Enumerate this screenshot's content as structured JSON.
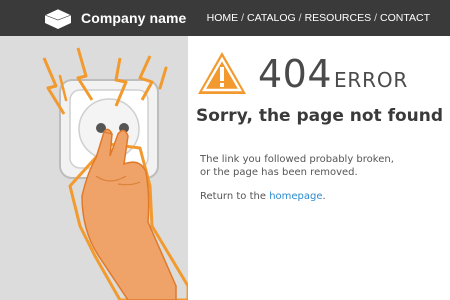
{
  "header": {
    "brand": "Company name",
    "nav": [
      {
        "label": "HOME"
      },
      {
        "label": "CATALOG"
      },
      {
        "label": "RESOURCES"
      },
      {
        "label": "CONTACT"
      }
    ],
    "separator": "/"
  },
  "error": {
    "code": "404",
    "word": "ERROR",
    "title": "Sorry, the page not found",
    "message_line1": "The link you followed probably broken,",
    "message_line2": "or the page has been removed.",
    "return_prefix": "Return to the",
    "return_link": "homepage",
    "return_suffix": "."
  },
  "colors": {
    "topbar": "#3a3a3a",
    "illustration_bg": "#dcdcdc",
    "accent_orange": "#f29a2e",
    "link": "#2a8bd0"
  },
  "icons": {
    "logo": "hexagon-logo-icon",
    "warning": "warning-triangle-icon"
  }
}
